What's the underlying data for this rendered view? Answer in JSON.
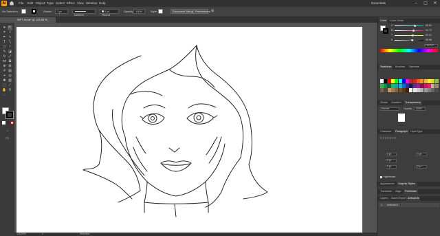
{
  "app": {
    "logo": "Ai"
  },
  "menu": [
    "File",
    "Edit",
    "Object",
    "Type",
    "Select",
    "Effect",
    "View",
    "Window",
    "Help"
  ],
  "workspace": "Essentials",
  "control": {
    "selection": "No Selection",
    "stroke_label": "Stroke:",
    "stroke_weight": "1 pt",
    "brush": "Uniform",
    "profile": "5 pt. Round",
    "opacity_label": "Opacity:",
    "opacity": "100%",
    "style_label": "Style:",
    "doc_setup": "Document Setup",
    "preferences": "Preferences"
  },
  "document_tab": {
    "label": "WF7-Art.ai* @ 125.59 % (RGB/Preview)",
    "close": "×"
  },
  "status": {
    "zoom": "125.59%",
    "artboard_num": "1",
    "tool": "Selection"
  },
  "panels": {
    "color": {
      "tabs": [
        "Color",
        "Color Guide"
      ],
      "channels": [
        {
          "name": "C",
          "value": "69.81"
        },
        {
          "name": "M",
          "value": "63.72"
        },
        {
          "name": "Y",
          "value": "62.21"
        },
        {
          "name": "K",
          "value": "59.98"
        }
      ],
      "hex": "FFFFFF"
    },
    "swatches": {
      "tabs": [
        "Swatches",
        "Brushes",
        "Symbols"
      ]
    },
    "stroke": {
      "tabs": [
        "Stroke",
        "Gradient",
        "Transparency"
      ],
      "mode": "Normal",
      "opacity_label": "Opacity:",
      "opacity": "100%"
    },
    "character": {
      "tabs": [
        "Character",
        "Paragraph",
        "OpenType"
      ],
      "fields": [
        "0 pt",
        "0 pt",
        "0 pt",
        "0 pt",
        "0 pt"
      ],
      "hyphenate": "Hyphenate"
    },
    "appearance": {
      "tabs": [
        "Appearance",
        "Graphic Styles"
      ]
    },
    "transform": {
      "tabs": [
        "Transform",
        "Align",
        "Pathfinder"
      ]
    },
    "layers": {
      "tabs": [
        "Layers",
        "Asset Export",
        "Artboards"
      ],
      "row_num": "1",
      "row_label": "Artboard 1"
    }
  },
  "colors": {
    "accent": "#ff9a00",
    "panel": "#3d3d3d",
    "swatch_row1": [
      "#ffffff",
      "#000000",
      "#ff0000",
      "#ffff00",
      "#00ff00",
      "#00ffff",
      "#0000ff",
      "#ff00ff",
      "#c1272d",
      "#ed1c24",
      "#f15a24",
      "#f7931e",
      "#fbb03b",
      "#fcee21",
      "#d9e021",
      "#8cc63f"
    ],
    "swatch_row2": [
      "#39b54a",
      "#009245",
      "#006837",
      "#22b573",
      "#00a99d",
      "#29abe2",
      "#0071bc",
      "#2e3192",
      "#1b1464",
      "#662d91",
      "#93278f",
      "#9e005d",
      "#d4145a",
      "#ed1e79",
      "#c7b299",
      "#998675"
    ],
    "swatch_row3": [
      "#736357",
      "#534741",
      "#c69c6d",
      "#a67c52",
      "#8c6239",
      "#754c24",
      "#603813",
      "#42210b",
      "#ffffff",
      "#e6e6e6",
      "#cccccc",
      "#b3b3b3",
      "#999999",
      "#808080",
      "#666666",
      "#4d4d4d"
    ]
  }
}
